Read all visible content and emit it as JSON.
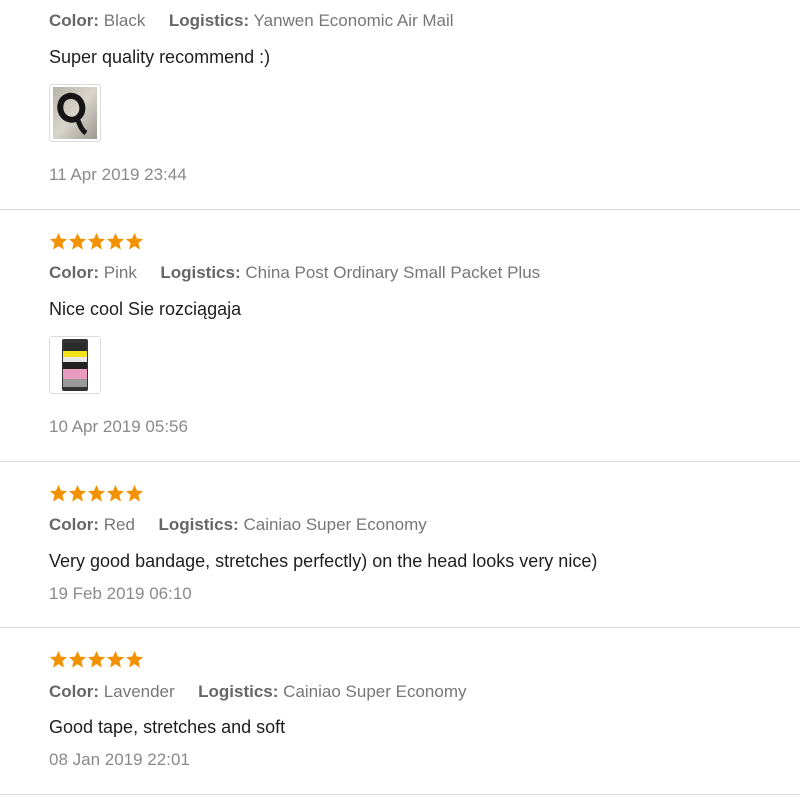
{
  "reviews": [
    {
      "stars": 0,
      "color_label": "Color:",
      "color_value": "Black",
      "logistics_label": "Logistics:",
      "logistics_value": "Yanwen Economic Air Mail",
      "text": "Super quality recommend :)",
      "date": "11 Apr 2019 23:44"
    },
    {
      "stars": 5,
      "color_label": "Color:",
      "color_value": "Pink",
      "logistics_label": "Logistics:",
      "logistics_value": "China Post Ordinary Small Packet Plus",
      "text": "Nice cool Sie rozciągaja",
      "date": "10 Apr 2019 05:56"
    },
    {
      "stars": 5,
      "color_label": "Color:",
      "color_value": "Red",
      "logistics_label": "Logistics:",
      "logistics_value": "Cainiao Super Economy",
      "text": "Very good bandage, stretches perfectly) on the head looks very nice)",
      "date": "19 Feb 2019 06:10"
    },
    {
      "stars": 5,
      "color_label": "Color:",
      "color_value": "Lavender",
      "logistics_label": "Logistics:",
      "logistics_value": "Cainiao Super Economy",
      "text": "Good tape, stretches and soft",
      "date": "08 Jan 2019 22:01"
    }
  ],
  "colors": {
    "star": "#f39200",
    "divider": "#d9d9d9",
    "meta_text": "#777777",
    "body_text": "#1e1e1e"
  },
  "icons": {
    "star": "star-icon",
    "photo": "review-photo"
  }
}
